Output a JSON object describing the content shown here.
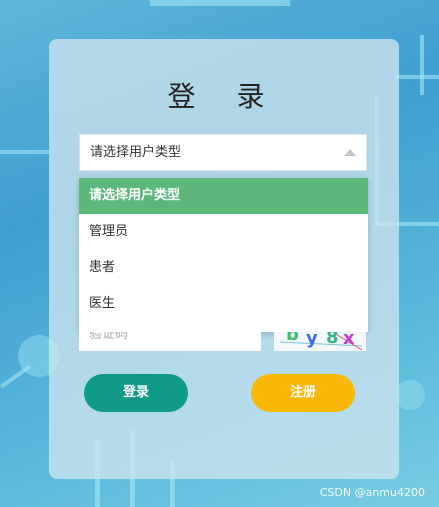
{
  "login": {
    "title": "登 录",
    "role_select": {
      "selected": "请选择用户类型",
      "options": [
        "请选择用户类型",
        "管理员",
        "患者",
        "医生"
      ]
    },
    "captcha": {
      "placeholder": "验证码",
      "image_text": "by8x"
    },
    "buttons": {
      "login": "登录",
      "register": "注册"
    }
  },
  "watermark": "CSDN @anmu4200",
  "colors": {
    "selected_option": "#5cb87a",
    "login_button": "#0f9a8a",
    "register_button": "#f9b708"
  },
  "icons": [
    "caret-up-icon"
  ]
}
